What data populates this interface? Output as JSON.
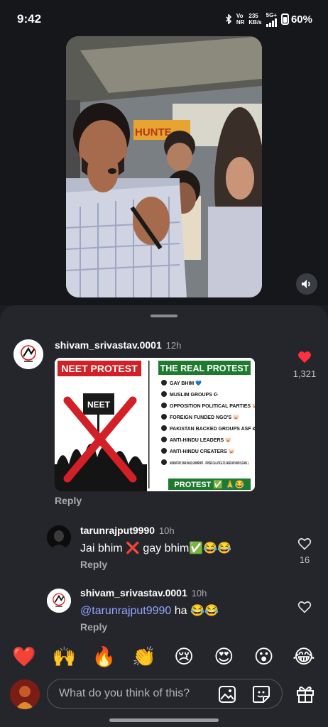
{
  "status_bar": {
    "time": "9:42",
    "network_top": "Vo",
    "network_bottom": "NR",
    "speed_top": "235",
    "speed_bottom": "KB/s",
    "cell_type": "5G+",
    "battery": "60%"
  },
  "video_overlay": {
    "banner_text": "HUNTE"
  },
  "comments": [
    {
      "username": "shivam_srivastav.0001",
      "time": "12h",
      "likes": "1,321",
      "liked": true,
      "reply_label": "Reply",
      "image": {
        "left_title": "NEET PROTEST",
        "sign_text": "NEET",
        "right_title": "THE REAL PROTEST",
        "items": [
          "GAY BHIM 💙",
          "MUSLIM GROUPS ☪",
          "OPPOSITION POLITICAL PARTIES 🐷",
          "FOREIGN FUNDED NGO'S 🐷",
          "PAKISTAN BACKED GROUPS ASF & SIF 🐷",
          "ANTI-HINDU LEADERS 🐷",
          "ANTI-HINDU CREATERS 🐷",
          "ARUNDHATI ROY, UMAR KHALID, KASHMIRI MP'S → OPPOSED CAA, ARTICLE 370, RAISED ANTI-HINDU SLOGANS 🐷"
        ],
        "footer": "PROTEST ✅ 🙏😂"
      }
    },
    {
      "username": "tarunrajput9990",
      "time": "10h",
      "text": "Jai bhim ❌ gay bhim✅😂😂",
      "likes": "16",
      "reply_label": "Reply"
    },
    {
      "username": "shivam_srivastav.0001",
      "time": "10h",
      "mention": "@tarunrajput9990",
      "text": " ha 😂😂",
      "reply_label": "Reply"
    }
  ],
  "quick_reactions": [
    "❤️",
    "🙌",
    "🔥",
    "👏",
    "😢",
    "😍",
    "😮",
    "😂"
  ],
  "composer": {
    "placeholder": "What do you think of this?"
  },
  "colors": {
    "sheet_bg": "#25262b",
    "like_red": "#ff3040",
    "mention_blue": "#8fa6ff",
    "neet_red": "#d32027",
    "real_green": "#1d7a2e"
  }
}
